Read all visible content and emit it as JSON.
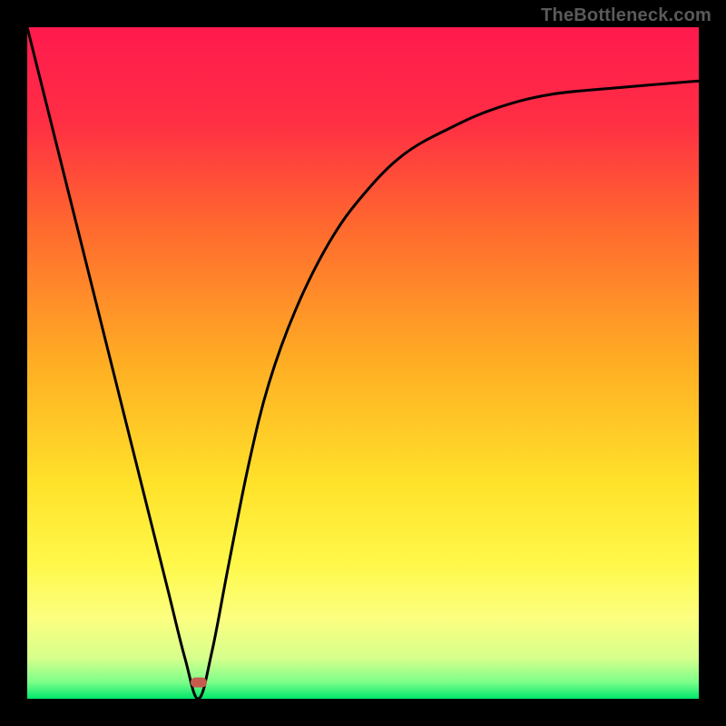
{
  "watermark": "TheBottleneck.com",
  "gradient_stops": [
    {
      "offset": 0,
      "color": "#ff1a4e"
    },
    {
      "offset": 0.14,
      "color": "#ff2e44"
    },
    {
      "offset": 0.3,
      "color": "#ff6a2e"
    },
    {
      "offset": 0.5,
      "color": "#ffae24"
    },
    {
      "offset": 0.68,
      "color": "#ffe22a"
    },
    {
      "offset": 0.8,
      "color": "#fff84a"
    },
    {
      "offset": 0.88,
      "color": "#fcff80"
    },
    {
      "offset": 0.94,
      "color": "#d6ff8c"
    },
    {
      "offset": 0.975,
      "color": "#7dff8a"
    },
    {
      "offset": 1.0,
      "color": "#00e66b"
    }
  ],
  "marker": {
    "x_frac": 0.255,
    "y_frac": 0.976
  },
  "chart_data": {
    "type": "line",
    "title": "",
    "xlabel": "",
    "ylabel": "",
    "xlim": [
      0,
      1
    ],
    "ylim": [
      0,
      1
    ],
    "series": [
      {
        "name": "bottleneck-curve",
        "x": [
          0.0,
          0.03,
          0.06,
          0.09,
          0.12,
          0.15,
          0.18,
          0.21,
          0.235,
          0.255,
          0.275,
          0.3,
          0.33,
          0.36,
          0.4,
          0.45,
          0.5,
          0.56,
          0.63,
          0.7,
          0.78,
          0.88,
          1.0
        ],
        "y": [
          1.0,
          0.88,
          0.76,
          0.64,
          0.52,
          0.4,
          0.28,
          0.16,
          0.06,
          0.0,
          0.07,
          0.2,
          0.35,
          0.47,
          0.58,
          0.68,
          0.75,
          0.81,
          0.85,
          0.88,
          0.9,
          0.91,
          0.92
        ]
      }
    ],
    "marker_point": {
      "x": 0.255,
      "y": 0.024
    },
    "note": "y is normalized height from bottom (0=bottom, 1=top); values estimated from pixel positions"
  }
}
